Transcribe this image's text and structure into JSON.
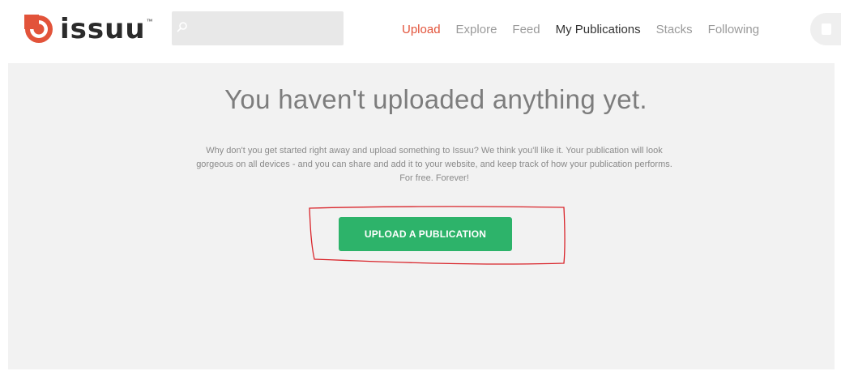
{
  "header": {
    "logo_text": "issuu",
    "logo_tm": "™",
    "search": {
      "placeholder": "",
      "value": ""
    },
    "nav": [
      {
        "label": "Upload",
        "state": "active"
      },
      {
        "label": "Explore",
        "state": "normal"
      },
      {
        "label": "Feed",
        "state": "normal"
      },
      {
        "label": "My Publications",
        "state": "strong"
      },
      {
        "label": "Stacks",
        "state": "normal"
      },
      {
        "label": "Following",
        "state": "normal"
      }
    ]
  },
  "main": {
    "headline": "You haven't uploaded anything yet.",
    "description": "Why don't you get started right away and upload something to Issuu? We think you'll like it. Your publication will look gorgeous on all devices - and you can share and add it to your website, and keep track of how your publication performs. For free. Forever!",
    "upload_button_label": "UPLOAD A PUBLICATION"
  },
  "colors": {
    "brand": "#e2533a",
    "button": "#2db36a",
    "highlight_annotation": "#d9242a",
    "panel_background": "#f2f2f2"
  },
  "icons": {
    "logo": "issuu-logo-icon",
    "search": "search-icon",
    "avatar": "user-avatar-icon"
  }
}
